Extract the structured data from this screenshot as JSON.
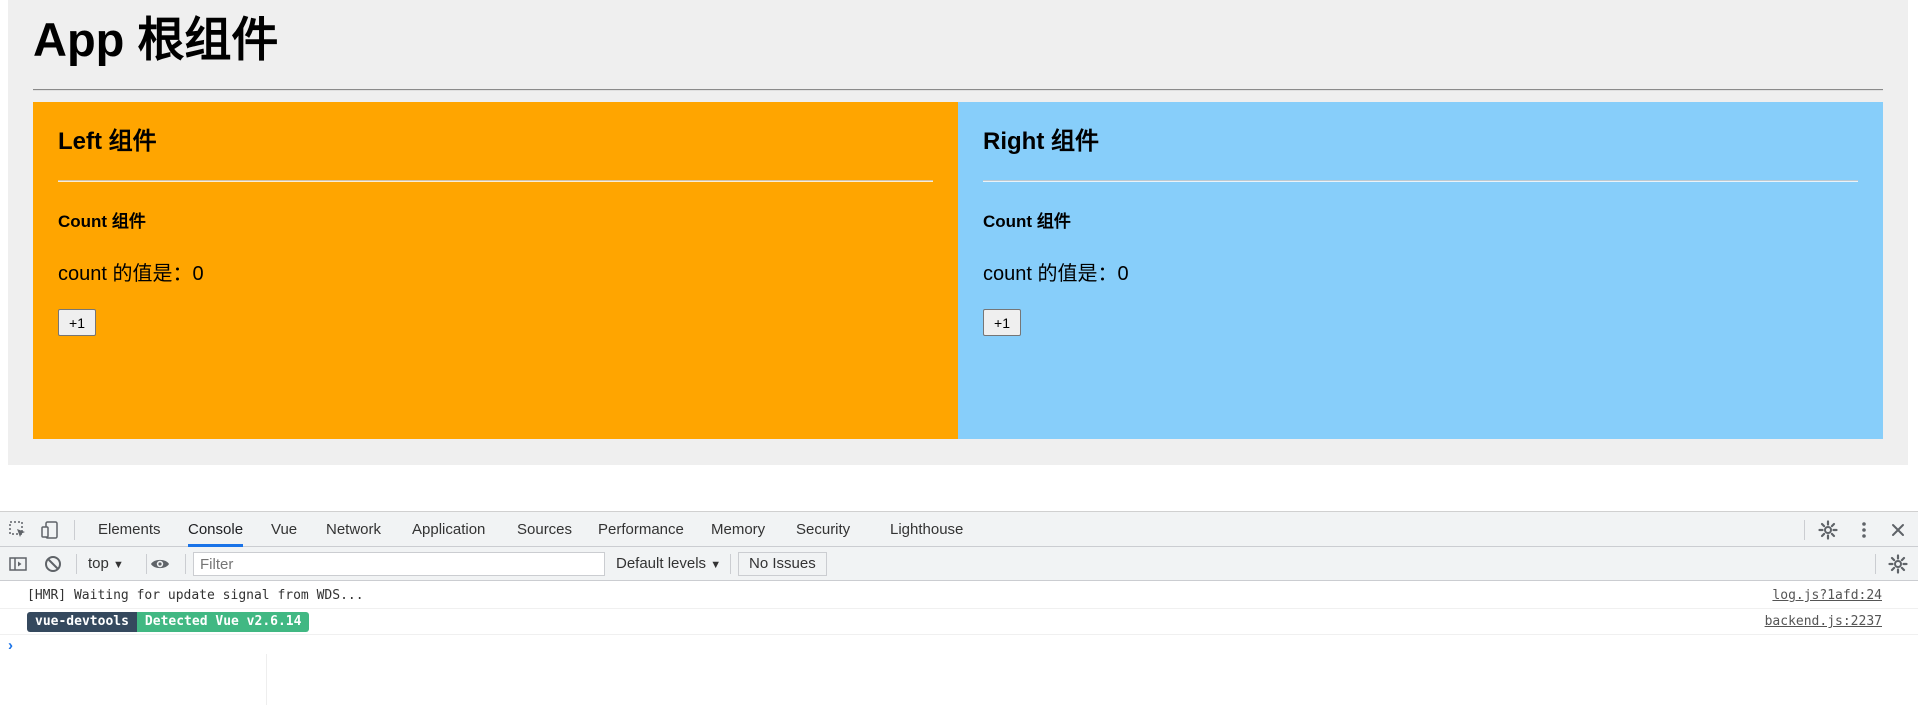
{
  "app": {
    "title": "App 根组件",
    "left": {
      "title": "Left 组件",
      "count_title": "Count 组件",
      "count_text": "count 的值是：0",
      "button_label": "+1",
      "color": "#ffa500"
    },
    "right": {
      "title": "Right 组件",
      "count_title": "Count 组件",
      "count_text": "count 的值是：0",
      "button_label": "+1",
      "color": "#87cefa"
    }
  },
  "devtools": {
    "tabs": [
      "Elements",
      "Console",
      "Vue",
      "Network",
      "Application",
      "Sources",
      "Performance",
      "Memory",
      "Security",
      "Lighthouse"
    ],
    "active_tab": "Console",
    "toolbar": {
      "context": "top",
      "filter_placeholder": "Filter",
      "levels": "Default levels",
      "issues": "No Issues"
    },
    "messages": [
      {
        "text": "[HMR] Waiting for update signal from WDS...",
        "source": "log.js?1afd:24"
      },
      {
        "badge_1": "vue-devtools",
        "badge_2": "Detected Vue v2.6.14",
        "source": "backend.js:2237"
      }
    ],
    "prompt": "›",
    "accent": "#1a73e8"
  }
}
